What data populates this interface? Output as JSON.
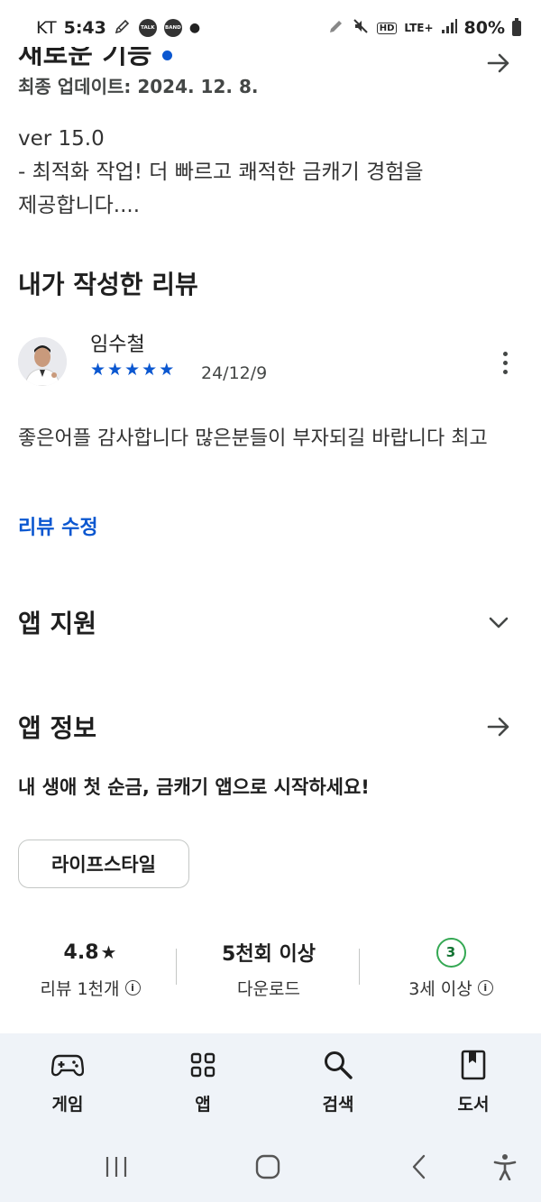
{
  "status_bar": {
    "carrier": "KT",
    "time": "5:43",
    "badge_talk": "TALK",
    "badge_band": "BAND",
    "hd": "HD",
    "network": "LTE+",
    "battery": "80%"
  },
  "whats_new": {
    "title": "새로운 기능",
    "updated": "최종 업데이트: 2024. 12. 8.",
    "lines": [
      "ver 15.0",
      "- 최적화 작업! 더 빠르고 쾌적한 금캐기 경험을",
      "제공합니다...."
    ]
  },
  "my_review": {
    "heading": "내가 작성한 리뷰",
    "name": "임수철",
    "stars": [
      "★",
      "★",
      "★",
      "★",
      "★"
    ],
    "rating": 5,
    "date": "24/12/9",
    "text": "좋은어플 감사합니다   많은분들이 부자되길 바랍니다 최고",
    "edit_label": "리뷰 수정"
  },
  "app_support": {
    "heading": "앱 지원"
  },
  "app_info": {
    "heading": "앱 정보",
    "tagline": "내 생애 첫 순금, 금캐기 앱으로 시작하세요!",
    "category": "라이프스타일"
  },
  "stats": {
    "rating_value": "4.8",
    "rating_star": "★",
    "rating_label": "리뷰 1천개",
    "downloads_value": "5천회 이상",
    "downloads_label": "다운로드",
    "age_badge": "3",
    "age_label": "3세 이상",
    "info_glyph": "i"
  },
  "bottom_nav": {
    "items": [
      {
        "label": "게임",
        "icon": "gamepad-icon"
      },
      {
        "label": "앱",
        "icon": "apps-grid-icon"
      },
      {
        "label": "검색",
        "icon": "search-icon"
      },
      {
        "label": "도서",
        "icon": "book-icon"
      }
    ]
  },
  "colors": {
    "accent": "#0b57d0",
    "age_green": "#34a853",
    "nav_bg": "#eff3f8"
  }
}
